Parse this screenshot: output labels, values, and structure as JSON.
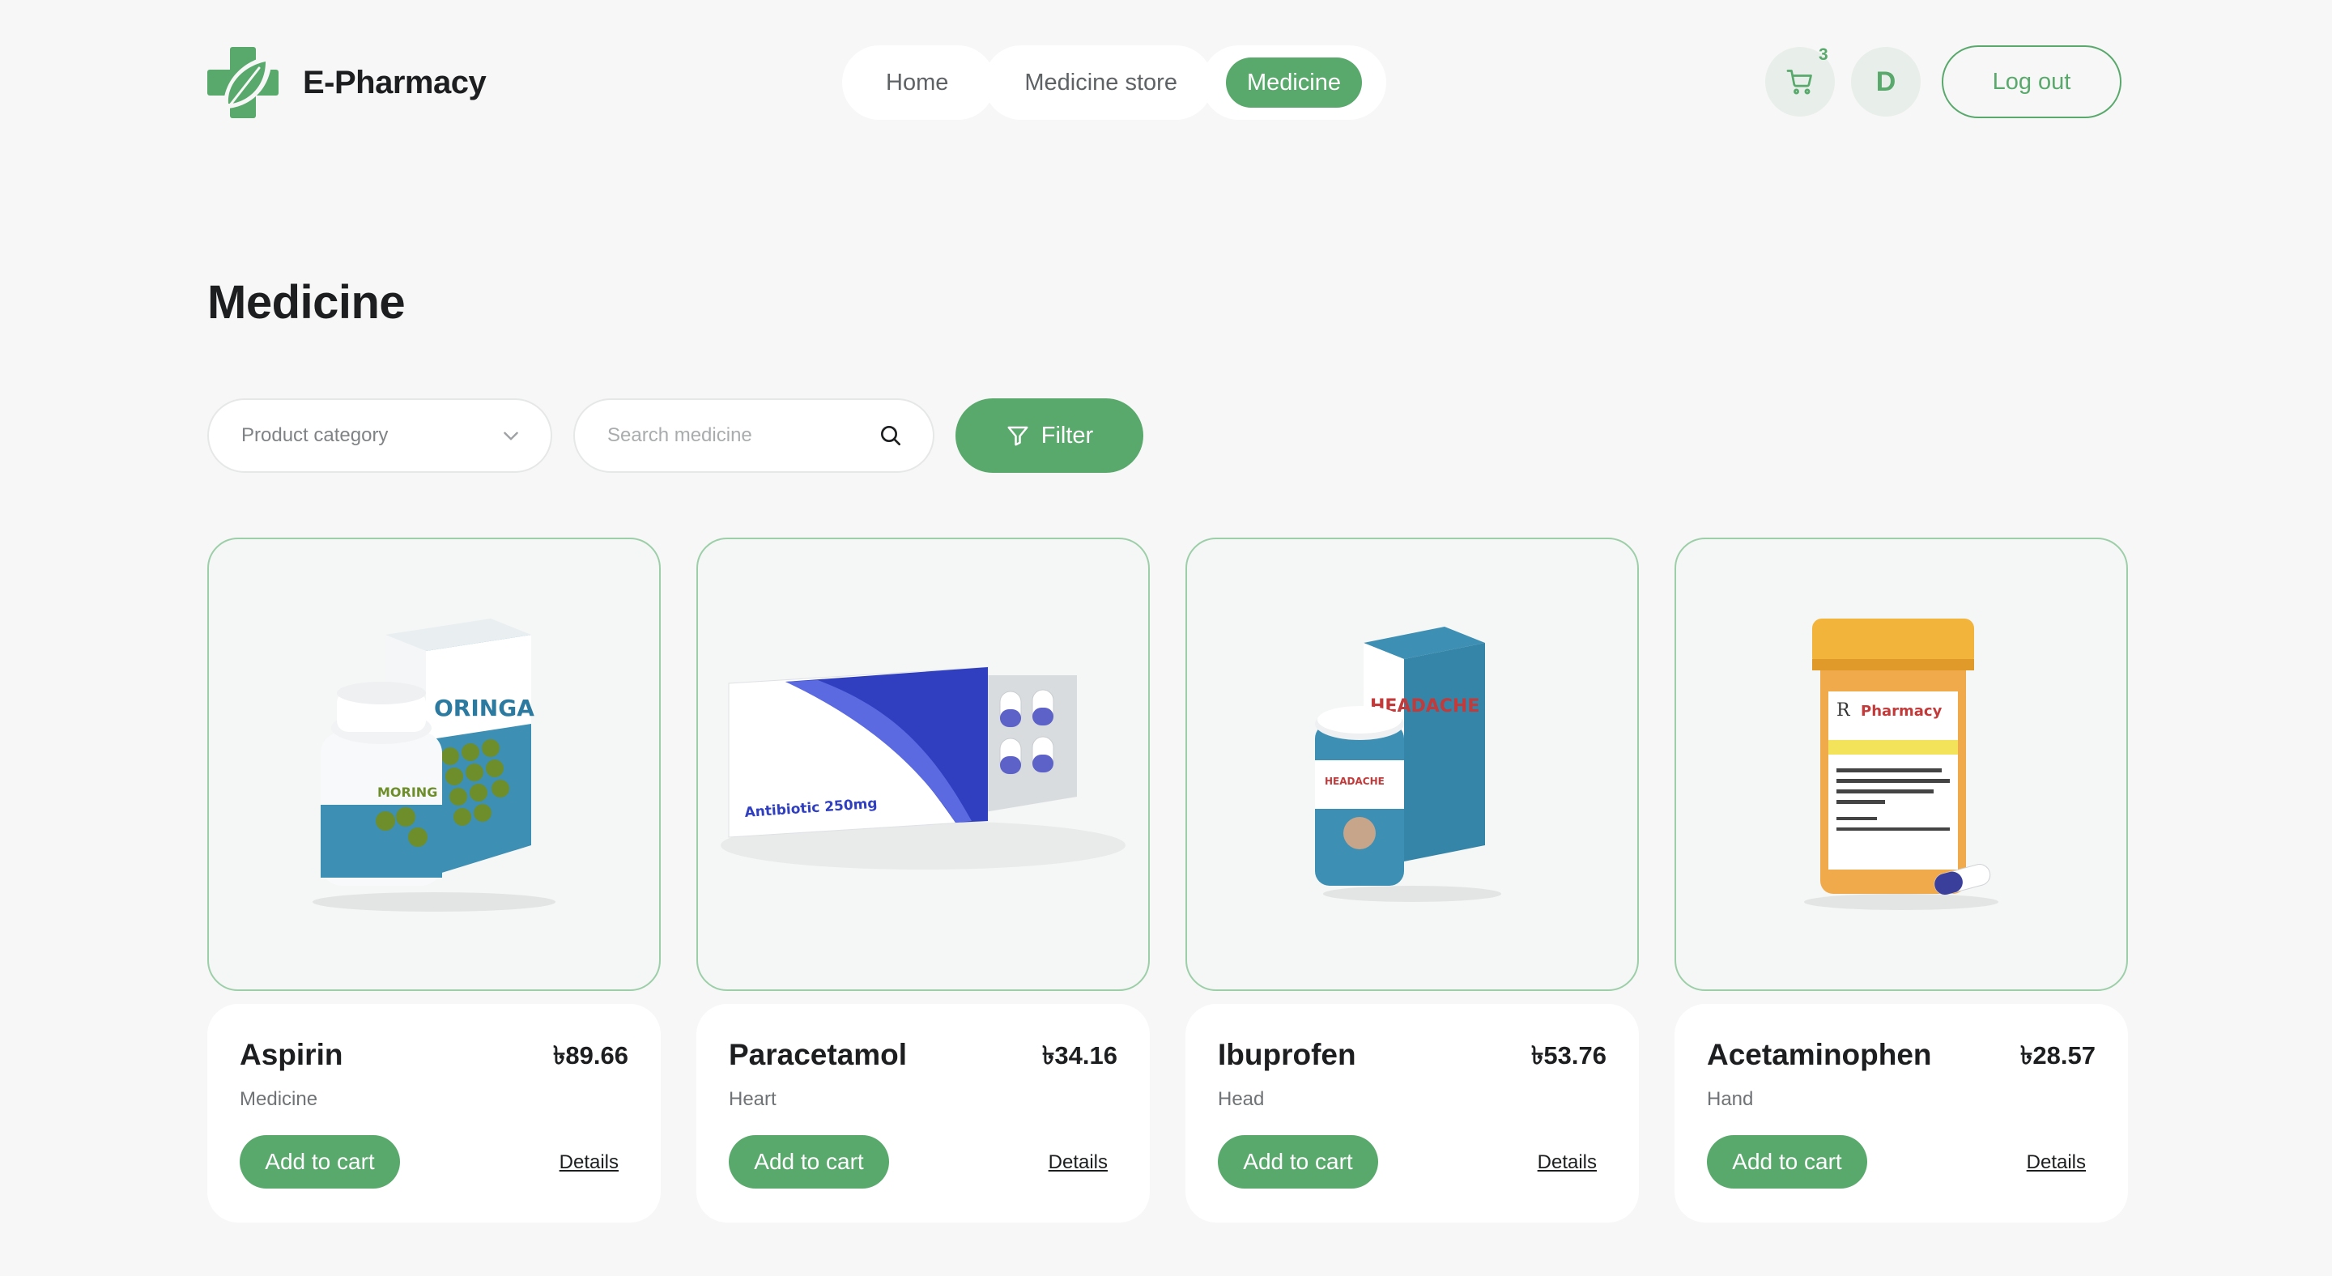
{
  "brand": {
    "name": "E-Pharmacy",
    "accent": "#59a96c"
  },
  "nav": {
    "items": [
      {
        "label": "Home"
      },
      {
        "label": "Medicine store"
      },
      {
        "label": "Medicine",
        "active": true
      }
    ]
  },
  "header": {
    "cart_count": "3",
    "avatar_initial": "D",
    "logout_label": "Log out",
    "cart_icon": "cart-icon"
  },
  "page": {
    "title": "Medicine"
  },
  "filters": {
    "category_placeholder": "Product category",
    "search_placeholder": "Search medicine",
    "filter_label": "Filter"
  },
  "products": [
    {
      "name": "Aspirin",
      "price": "৳89.66",
      "category": "Medicine",
      "add_label": "Add to cart",
      "details_label": "Details",
      "image": "moringa-supplement"
    },
    {
      "name": "Paracetamol",
      "price": "৳34.16",
      "category": "Heart",
      "add_label": "Add to cart",
      "details_label": "Details",
      "image": "antibiotic-blister-pack",
      "image_text": "Antibiotic 250mg"
    },
    {
      "name": "Ibuprofen",
      "price": "৳53.76",
      "category": "Head",
      "add_label": "Add to cart",
      "details_label": "Details",
      "image": "headache-relief-box",
      "image_text": "HEADACHE"
    },
    {
      "name": "Acetaminophen",
      "price": "৳28.57",
      "category": "Hand",
      "add_label": "Add to cart",
      "details_label": "Details",
      "image": "prescription-bottle",
      "image_text": "Pharmacy"
    }
  ]
}
